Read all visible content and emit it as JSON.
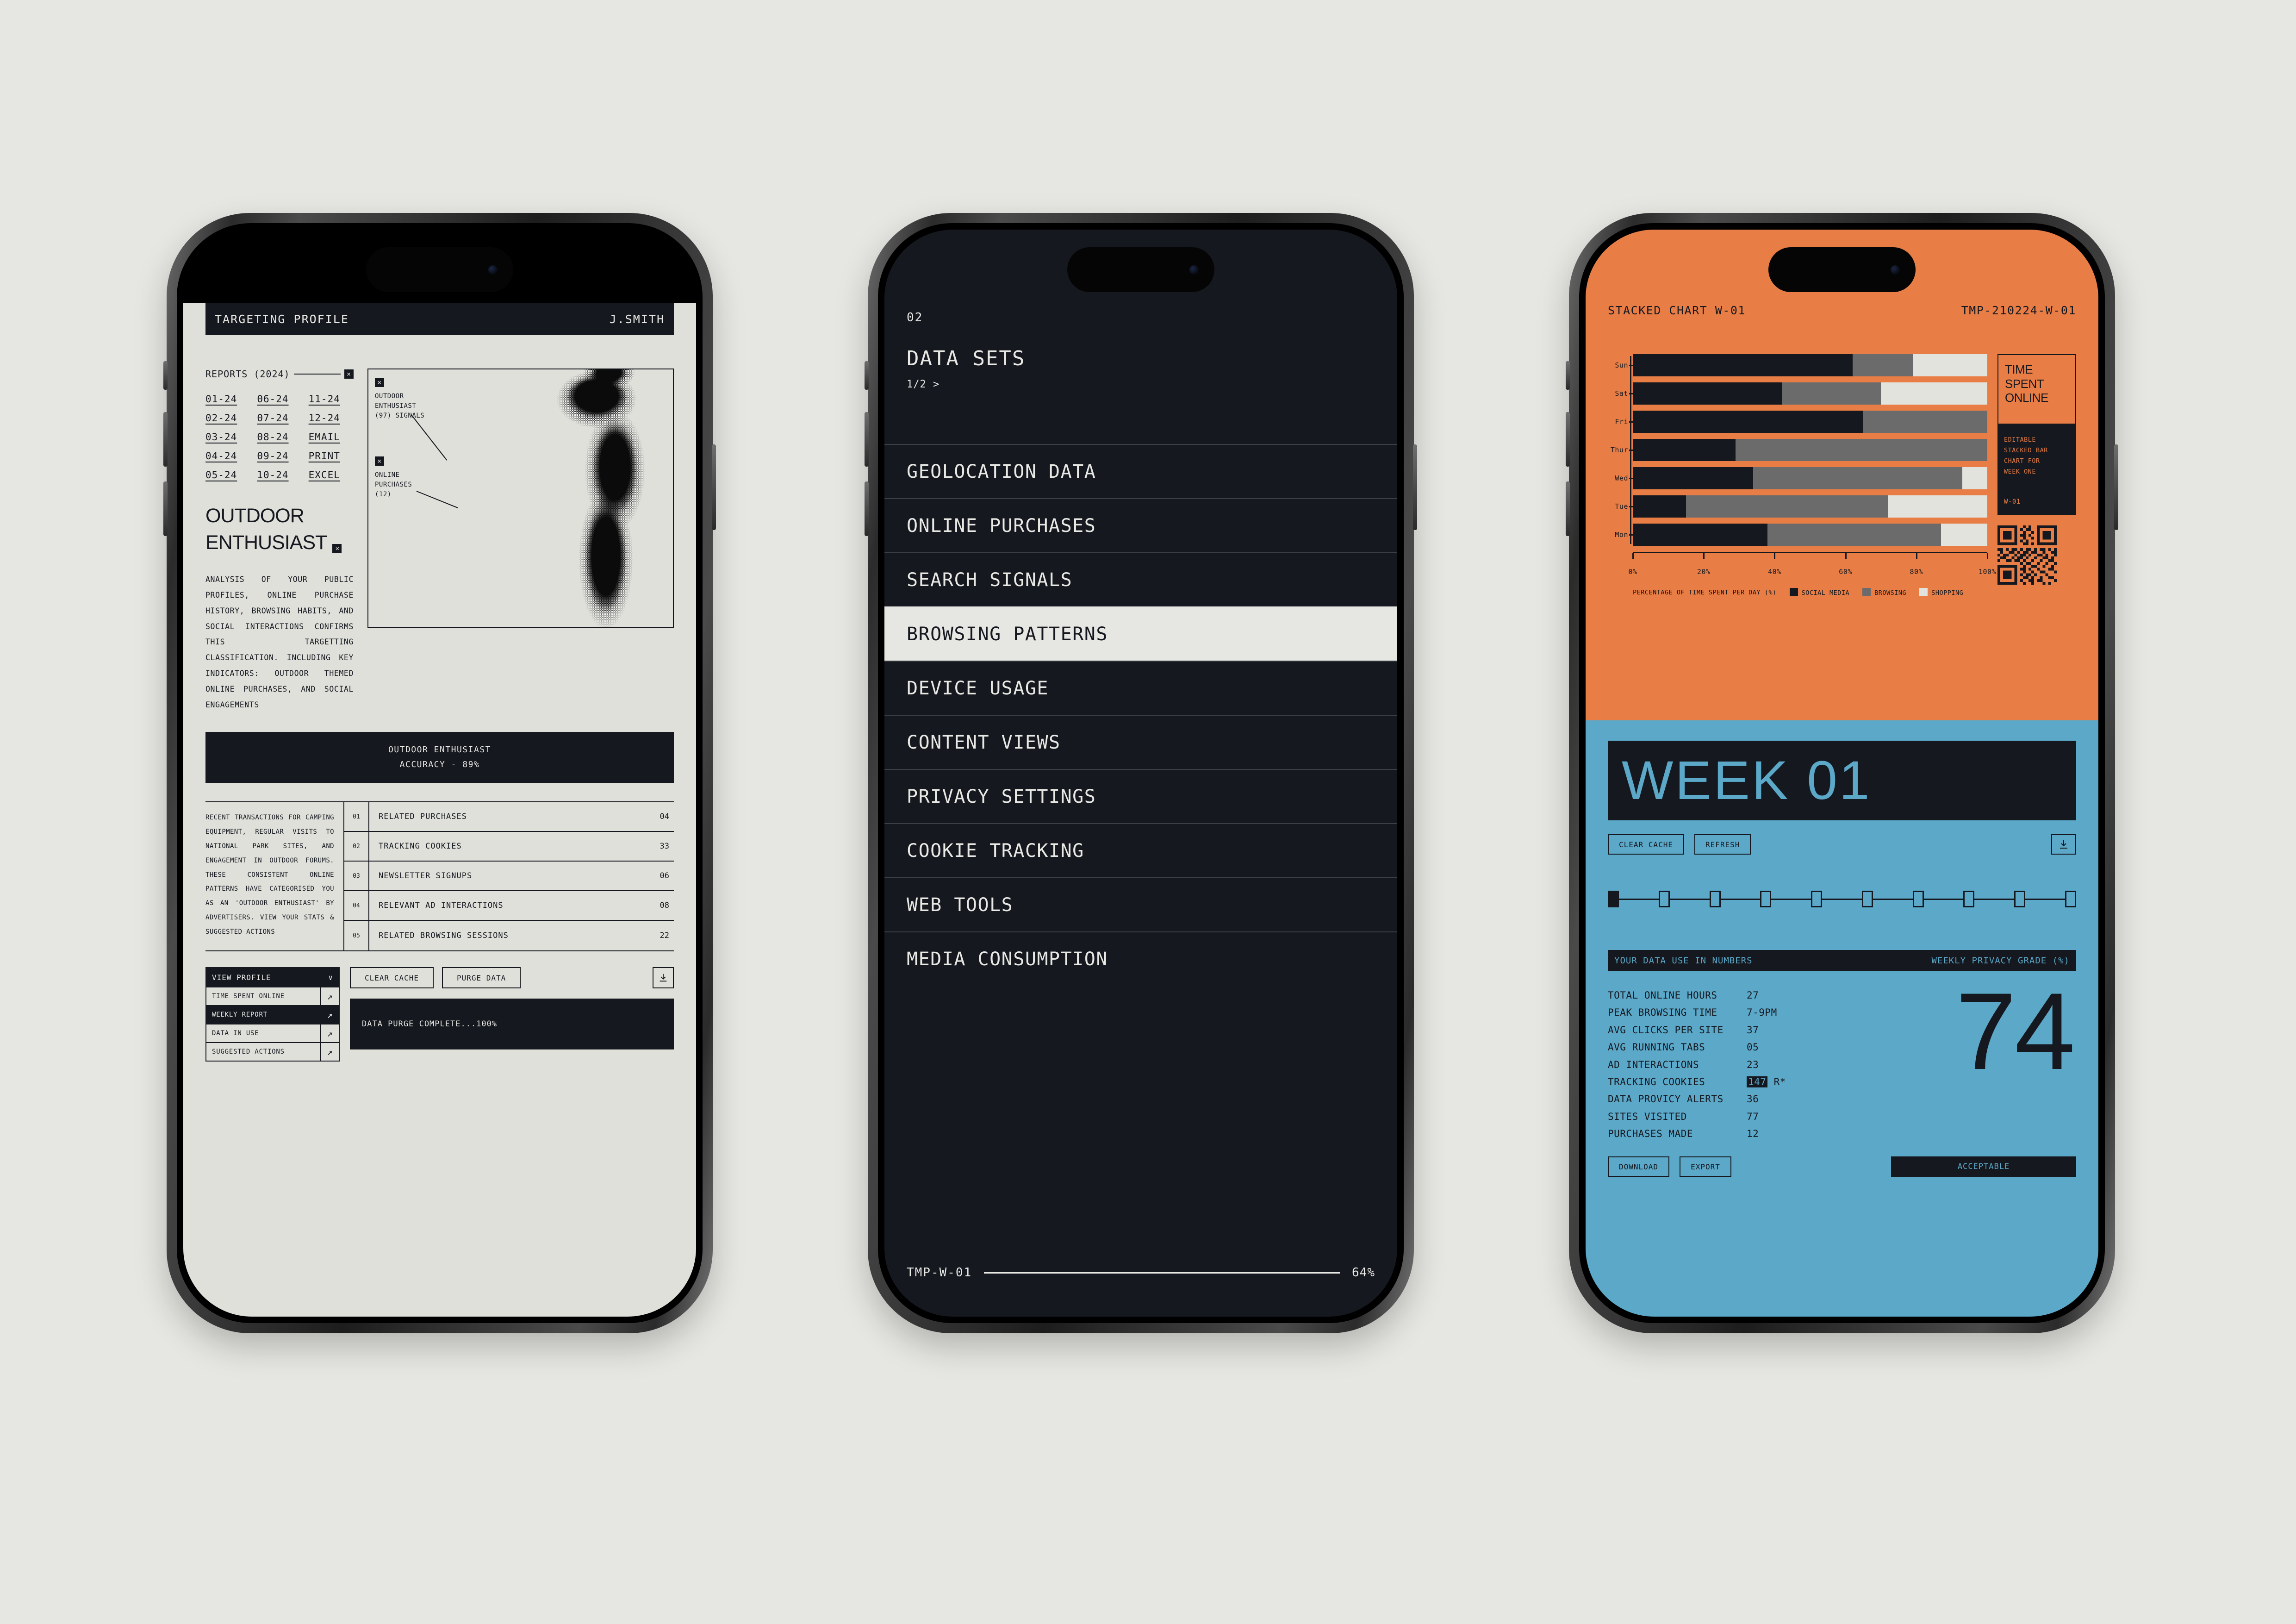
{
  "phone1": {
    "header": {
      "title": "TARGETING PROFILE",
      "user": "J.SMITH"
    },
    "reports": {
      "label": "REPORTS (2024)",
      "close_icon": "x-icon",
      "links": [
        "01-24",
        "06-24",
        "11-24",
        "02-24",
        "07-24",
        "12-24",
        "03-24",
        "08-24",
        "EMAIL",
        "04-24",
        "09-24",
        "PRINT",
        "05-24",
        "10-24",
        "EXCEL"
      ]
    },
    "title": "OUTDOOR\nENTHUSIAST",
    "title_line1": "OUTDOOR",
    "title_line2": "ENTHUSIAST",
    "paragraph": "ANALYSIS OF YOUR PUBLIC PROFILES, ONLINE PURCHASE HISTORY, BROWSING HABITS, AND SOCIAL INTERACTIONS CONFIRMS THIS TARGETTING CLASSIFICATION. INCLUDING KEY INDICATORS: OUTDOOR THEMED ONLINE PURCHASES, AND SOCIAL ENGAGEMENTS",
    "photo_annotations": {
      "a1": "OUTDOOR\nENTHUSIAST\n(97) SIGNALS",
      "a1_l1": "OUTDOOR",
      "a1_l2": "ENTHUSIAST",
      "a1_l3": "(97) SIGNALS",
      "a2_l1": "ONLINE",
      "a2_l2": "PURCHASES",
      "a2_l3": "(12)"
    },
    "banner": {
      "line1": "OUTDOOR ENTHUSIAST",
      "line2": "ACCURACY - 89%"
    },
    "table_note": "RECENT TRANSACTIONS FOR CAMPING EQUIPMENT, REGULAR VISITS TO NATIONAL PARK SITES, AND ENGAGEMENT IN OUTDOOR FORUMS. THESE CONSISTENT ONLINE PATTERNS HAVE CATEGORISED YOU AS AN 'OUTDOOR ENTHUSIAST' BY ADVERTISERS. VIEW YOUR STATS & SUGGESTED ACTIONS",
    "table_rows": [
      {
        "num": "01",
        "label": "RELATED PURCHASES",
        "value": "04"
      },
      {
        "num": "02",
        "label": "TRACKING COOKIES",
        "value": "33"
      },
      {
        "num": "03",
        "label": "NEWSLETTER SIGNUPS",
        "value": "06"
      },
      {
        "num": "04",
        "label": "RELEVANT AD INTERACTIONS",
        "value": "08"
      },
      {
        "num": "05",
        "label": "RELATED BROWSING SESSIONS",
        "value": "22"
      }
    ],
    "dropdown": {
      "selected": "VIEW PROFILE",
      "chevron_icon": "chevron-down-icon",
      "items": [
        {
          "label": "TIME SPENT ONLINE",
          "icon": "arrow-up-right-icon"
        },
        {
          "label": "WEEKLY REPORT",
          "icon": "arrow-up-right-icon"
        },
        {
          "label": "DATA IN USE",
          "icon": "arrow-up-right-icon"
        },
        {
          "label": "SUGGESTED ACTIONS",
          "icon": "arrow-up-right-icon"
        }
      ]
    },
    "buttons": {
      "clear_cache": "CLEAR CACHE",
      "purge_data": "PURGE DATA",
      "download_icon": "download-icon"
    },
    "terminal": "DATA PURGE COMPLETE...100%"
  },
  "phone2": {
    "section_number": "02",
    "heading": "DATA SETS",
    "pagination": "1/2 >",
    "menu": [
      "GEOLOCATION DATA",
      "ONLINE PURCHASES",
      "SEARCH SIGNALS",
      "BROWSING PATTERNS",
      "DEVICE USAGE",
      "CONTENT VIEWS",
      "PRIVACY SETTINGS",
      "COOKIE TRACKING",
      "WEB TOOLS",
      "MEDIA CONSUMPTION"
    ],
    "active_index": 3,
    "footer": {
      "code": "TMP-W-01",
      "percent": "64%"
    }
  },
  "phone3": {
    "header": {
      "title": "STACKED CHART W-01",
      "code": "TMP-210224-W-01"
    },
    "side_panel": {
      "title_l1": "TIME",
      "title_l2": "SPENT",
      "title_l3": "ONLINE",
      "desc_l1": "EDITABLE",
      "desc_l2": "STACKED BAR",
      "desc_l3": "CHART FOR",
      "desc_l4": "WEEK ONE",
      "tag": "W-01",
      "qr_icon": "qr-code-icon"
    },
    "week_title": "WEEK 01",
    "buttons": {
      "clear_cache": "CLEAR CACHE",
      "refresh": "REFRESH",
      "download_icon": "download-icon"
    },
    "steps": {
      "total": 10,
      "current": 1
    },
    "stats_header": {
      "left": "YOUR DATA USE IN NUMBERS",
      "right": "WEEKLY PRIVACY GRADE (%)"
    },
    "stats": [
      {
        "key": "TOTAL ONLINE HOURS",
        "value": "27"
      },
      {
        "key": "PEAK BROWSING TIME",
        "value": "7-9PM"
      },
      {
        "key": "AVG CLICKS PER SITE",
        "value": "37"
      },
      {
        "key": "AVG RUNNING TABS",
        "value": "05"
      },
      {
        "key": "AD INTERACTIONS",
        "value": "23"
      },
      {
        "key": "TRACKING COOKIES",
        "value": "147",
        "suffix": "R*",
        "highlight": true
      },
      {
        "key": "DATA PROVICY ALERTS",
        "value": "36"
      },
      {
        "key": "SITES VISITED",
        "value": "77"
      },
      {
        "key": "PURCHASES MADE",
        "value": "12"
      }
    ],
    "grade": "74",
    "footer_buttons": {
      "download": "DOWNLOAD",
      "export": "EXPORT",
      "status": "ACCEPTABLE"
    }
  },
  "colors": {
    "page_bg": "#e6e7e2",
    "ink": "#15181f",
    "paper": "#dfe0da",
    "orange": "#e87e45",
    "blue": "#5ba8c8",
    "seg_social": "#15181f",
    "seg_browsing": "#6b6b6b",
    "seg_shopping": "#e2e3dd"
  },
  "chart_data": {
    "type": "bar",
    "title": "STACKED CHART W-01",
    "subtitle": "TIME SPENT ONLINE",
    "xlabel": "PERCENTAGE OF TIME SPENT PER DAY (%)",
    "ylabel": "",
    "stacked": true,
    "orientation": "horizontal",
    "xlim": [
      0,
      100
    ],
    "xticks": [
      0,
      20,
      40,
      60,
      80,
      100
    ],
    "xtick_labels": [
      "0%",
      "20%",
      "40%",
      "60%",
      "80%",
      "100%"
    ],
    "grid": false,
    "legend_position": "bottom",
    "categories": [
      "Sun",
      "Sat",
      "Fri",
      "Thur",
      "Wed",
      "Tue",
      "Mon"
    ],
    "series": [
      {
        "name": "SOCIAL MEDIA",
        "color": "#15181f",
        "values": [
          62,
          42,
          65,
          29,
          34,
          15,
          38
        ]
      },
      {
        "name": "BROWSING",
        "color": "#6b6b6b",
        "values": [
          17,
          28,
          35,
          71,
          59,
          57,
          49
        ]
      },
      {
        "name": "SHOPPING",
        "color": "#e2e3dd",
        "values": [
          21,
          30,
          0,
          0,
          7,
          28,
          13
        ]
      }
    ]
  }
}
